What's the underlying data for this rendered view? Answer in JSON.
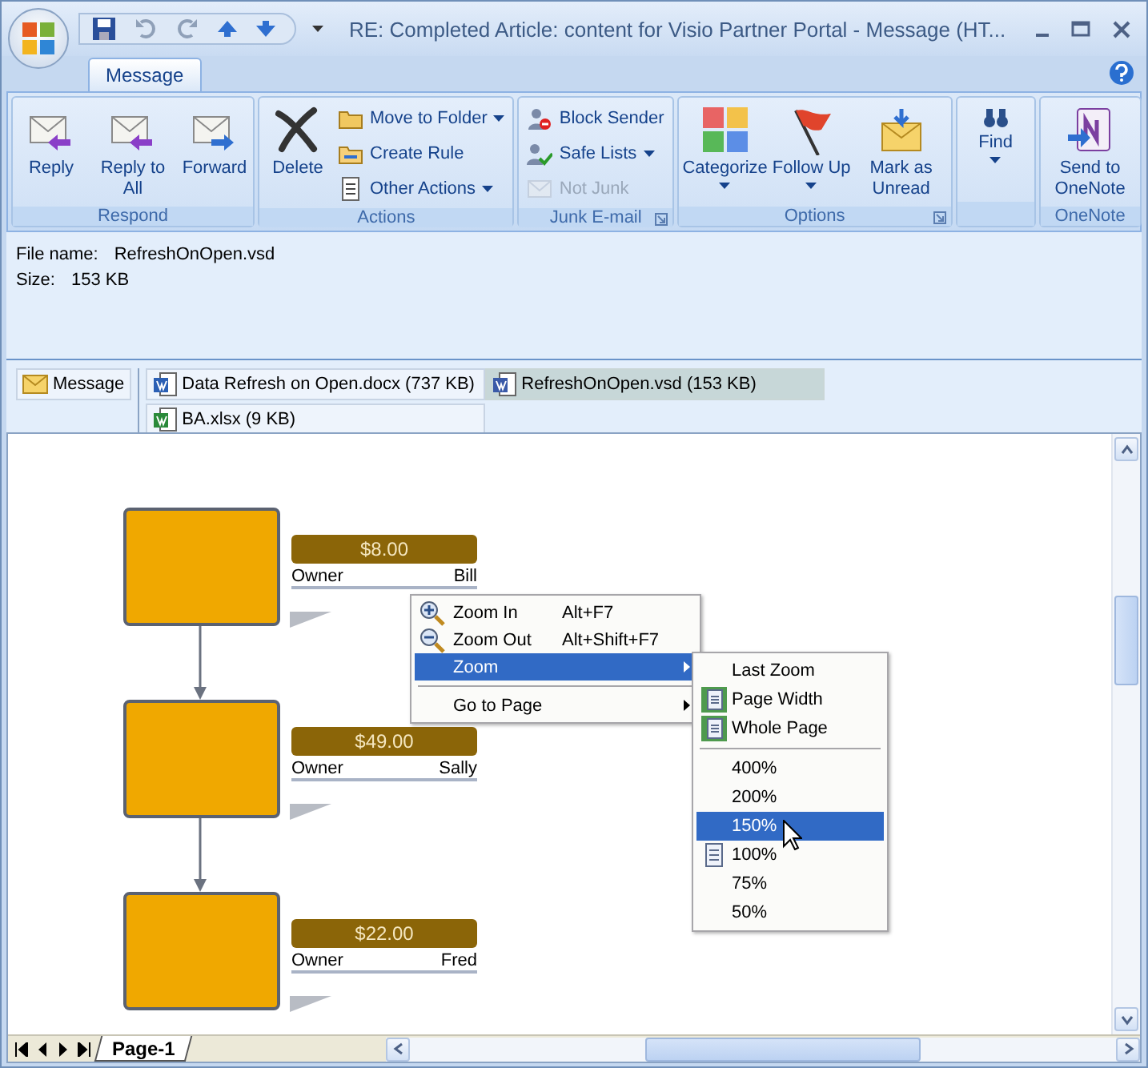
{
  "window": {
    "title": "RE: Completed Article: content for Visio Partner Portal - Message (HT..."
  },
  "tabs": [
    {
      "label": "Message",
      "selected": true
    }
  ],
  "ribbon": [
    {
      "label": "Respond",
      "launcher": false,
      "buttons": [
        {
          "label": "Reply",
          "kind": "large",
          "dropdown": false,
          "disabled": false
        },
        {
          "label": "Reply to All",
          "kind": "large",
          "dropdown": false,
          "disabled": false
        },
        {
          "label": "Forward",
          "kind": "large",
          "dropdown": false,
          "disabled": false
        }
      ]
    },
    {
      "label": "Actions",
      "launcher": false,
      "buttons": [
        {
          "label": "Delete",
          "kind": "large",
          "dropdown": false,
          "disabled": false
        },
        {
          "label": "Move to Folder",
          "kind": "small",
          "dropdown": true,
          "disabled": false
        },
        {
          "label": "Create Rule",
          "kind": "small",
          "dropdown": false,
          "disabled": false
        },
        {
          "label": "Other Actions",
          "kind": "small",
          "dropdown": true,
          "disabled": false
        }
      ]
    },
    {
      "label": "Junk E-mail",
      "launcher": true,
      "buttons": [
        {
          "label": "Block Sender",
          "kind": "small",
          "dropdown": false,
          "disabled": false
        },
        {
          "label": "Safe Lists",
          "kind": "small",
          "dropdown": true,
          "disabled": false
        },
        {
          "label": "Not Junk",
          "kind": "small",
          "dropdown": false,
          "disabled": true
        }
      ]
    },
    {
      "label": "Options",
      "launcher": true,
      "buttons": [
        {
          "label": "Categorize",
          "kind": "large",
          "dropdown": true,
          "disabled": false
        },
        {
          "label": "Follow Up",
          "kind": "large",
          "dropdown": true,
          "disabled": false
        },
        {
          "label": "Mark as Unread",
          "kind": "large",
          "dropdown": false,
          "disabled": false
        }
      ]
    },
    {
      "launcher": false,
      "buttons": [
        {
          "label": "Find",
          "kind": "large",
          "dropdown": true,
          "disabled": false
        }
      ]
    },
    {
      "label": "OneNote",
      "launcher": false,
      "buttons": [
        {
          "label": "Send to OneNote",
          "kind": "large",
          "dropdown": false,
          "disabled": false
        }
      ]
    }
  ],
  "file_info": [
    {
      "label": "File name:",
      "value": "RefreshOnOpen.vsd"
    },
    {
      "label": "Size:",
      "value": "153 KB"
    }
  ],
  "attachments": [
    {
      "label": "Message",
      "kind": "message",
      "selected": false
    },
    {
      "label": "Data Refresh on Open.docx (737 KB)",
      "kind": "word",
      "selected": false
    },
    {
      "label": "RefreshOnOpen.vsd (153 KB)",
      "kind": "visio",
      "selected": true
    },
    {
      "label": "BA.xlsx (9 KB)",
      "kind": "excel",
      "selected": false
    }
  ],
  "diagram": {
    "nodes": [
      {
        "amount": "$8.00",
        "field": "Owner",
        "value": "Bill"
      },
      {
        "amount": "$49.00",
        "field": "Owner",
        "value": "Sally"
      },
      {
        "amount": "$22.00",
        "field": "Owner",
        "value": "Fred"
      }
    ]
  },
  "context_menu": [
    {
      "kind": "item",
      "label": "Zoom In",
      "shortcut": "Alt+F7",
      "submenu": false,
      "selected": false
    },
    {
      "kind": "item",
      "label": "Zoom Out",
      "shortcut": "Alt+Shift+F7",
      "submenu": false,
      "selected": false
    },
    {
      "kind": "item",
      "label": "Zoom",
      "submenu": true,
      "selected": true
    },
    {
      "kind": "separator"
    },
    {
      "kind": "item",
      "label": "Go to Page",
      "submenu": true,
      "selected": false
    }
  ],
  "zoom_menu": [
    {
      "kind": "item",
      "label": "Last Zoom",
      "selected": false
    },
    {
      "kind": "item",
      "label": "Page Width",
      "selected": false
    },
    {
      "kind": "item",
      "label": "Whole Page",
      "selected": false
    },
    {
      "kind": "separator"
    },
    {
      "kind": "item",
      "label": "400%",
      "selected": false
    },
    {
      "kind": "item",
      "label": "200%",
      "selected": false
    },
    {
      "kind": "item",
      "label": "150%",
      "selected": true
    },
    {
      "kind": "item",
      "label": "100%",
      "selected": false
    },
    {
      "kind": "item",
      "label": "75%",
      "selected": false
    },
    {
      "kind": "item",
      "label": "50%",
      "selected": false
    }
  ],
  "page_tabs": [
    {
      "label": "Page-1",
      "selected": true
    }
  ]
}
